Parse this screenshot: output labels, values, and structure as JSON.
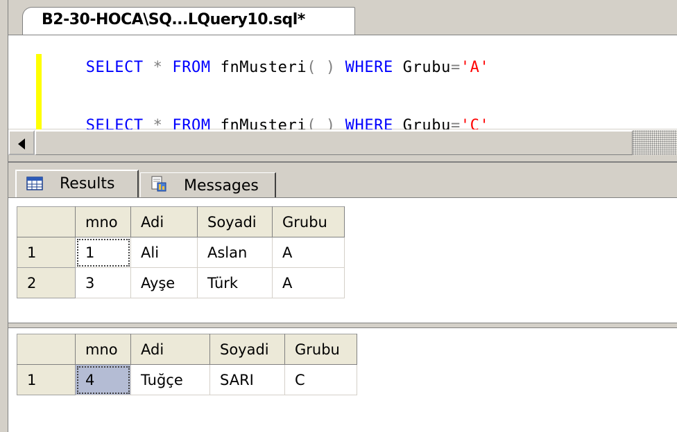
{
  "window": {
    "tab_title": "B2-30-HOCA\\SQ...LQuery10.sql*"
  },
  "editor": {
    "lines": [
      {
        "kw1": "SELECT",
        "op1": "*",
        "kw2": "FROM",
        "id1": "fnMusteri",
        "op2": "( )",
        "kw3": "WHERE",
        "id2": "Grubu",
        "op3": "=",
        "str": "'A'"
      },
      {
        "kw1": "SELECT",
        "op1": "*",
        "kw2": "FROM",
        "id1": "fnMusteri",
        "op2": "( )",
        "kw3": "WHERE",
        "id2": "Grubu",
        "op3": "=",
        "str": "'C'"
      }
    ]
  },
  "result_tabs": {
    "results_label": "Results",
    "messages_label": "Messages",
    "results_icon": "grid-icon",
    "messages_icon": "messages-icon"
  },
  "grid1": {
    "columns": [
      "mno",
      "Adi",
      "Soyadi",
      "Grubu"
    ],
    "rows": [
      {
        "num": "1",
        "cells": [
          "1",
          "Ali",
          "Aslan",
          "A"
        ]
      },
      {
        "num": "2",
        "cells": [
          "3",
          "Ayşe",
          "Türk",
          "A"
        ]
      }
    ]
  },
  "grid2": {
    "columns": [
      "mno",
      "Adi",
      "Soyadi",
      "Grubu"
    ],
    "rows": [
      {
        "num": "1",
        "cells": [
          "4",
          "Tuğçe",
          "SARI",
          "C"
        ]
      }
    ]
  }
}
